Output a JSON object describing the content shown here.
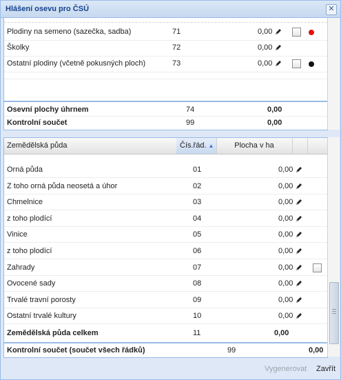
{
  "window": {
    "title": "Hlášení osevu pro ČSÚ"
  },
  "top_table": {
    "rows": [
      {
        "label": "Plodiny na semeno (sazečka, sadba)",
        "num": "71",
        "value": "0,00",
        "checkbox": true,
        "dot_color": "#e01010"
      },
      {
        "label": "Školky",
        "num": "72",
        "value": "0,00",
        "checkbox": false,
        "dot_color": ""
      },
      {
        "label": "Ostatní plodiny (včetně pokusných ploch)",
        "num": "73",
        "value": "0,00",
        "checkbox": true,
        "dot_color": "#111111"
      }
    ],
    "summary": [
      {
        "label": "Osevní plochy úhrnem",
        "num": "74",
        "value": "0,00"
      },
      {
        "label": "Kontrolní součet",
        "num": "99",
        "value": "0,00"
      }
    ]
  },
  "bottom_table": {
    "headers": {
      "col1": "Zemědělská půda",
      "col2": "Čís.řád.",
      "col3": "Plocha v ha"
    },
    "rows": [
      {
        "label": "Orná půda",
        "num": "01",
        "value": "0,00",
        "checkbox": false
      },
      {
        "label": "Z toho orná půda neosetá a úhor",
        "num": "02",
        "value": "0,00",
        "checkbox": false
      },
      {
        "label": "Chmelnice",
        "num": "03",
        "value": "0,00",
        "checkbox": false
      },
      {
        "label": "z toho plodící",
        "num": "04",
        "value": "0,00",
        "checkbox": false
      },
      {
        "label": "Vinice",
        "num": "05",
        "value": "0,00",
        "checkbox": false
      },
      {
        "label": "z toho plodící",
        "num": "06",
        "value": "0,00",
        "checkbox": false
      },
      {
        "label": "Zahrady",
        "num": "07",
        "value": "0,00",
        "checkbox": true
      },
      {
        "label": "Ovocené sady",
        "num": "08",
        "value": "0,00",
        "checkbox": false
      },
      {
        "label": "Trvalé travní porosty",
        "num": "09",
        "value": "0,00",
        "checkbox": false
      },
      {
        "label": "Ostatní trvalé kultury",
        "num": "10",
        "value": "0,00",
        "checkbox": false
      }
    ],
    "total": {
      "label": "Zemědělská půda celkem",
      "num": "11",
      "value": "0,00"
    },
    "control": {
      "label": "Kontrolní součet (součet všech řádků)",
      "num": "99",
      "value": "0,00"
    }
  },
  "buttons": {
    "generate": "Vygenerovat",
    "close": "Zavřít"
  }
}
